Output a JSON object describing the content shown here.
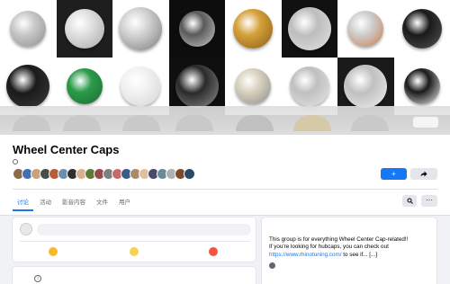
{
  "cover": {
    "tiles": [
      {
        "bg": "#ffffff",
        "cap": "#c9c9c9",
        "rim": "#8d8d8d"
      },
      {
        "bg": "#1e1e1e",
        "cap": "#e0e0e0",
        "rim": "#a6a6a6"
      },
      {
        "bg": "#ffffff",
        "cap": "#d2d2d2",
        "rim": "#7a7a7a"
      },
      {
        "bg": "#0d0d0d",
        "cap": "#5a5a5a",
        "rim": "#c8c8c8"
      },
      {
        "bg": "#ffffff",
        "cap": "#d4a13a",
        "rim": "#8a5b14"
      },
      {
        "bg": "#111111",
        "cap": "#bdbdbd",
        "rim": "#e3e3e3"
      },
      {
        "bg": "#ffffff",
        "cap": "#cfcfcf",
        "rim": "#c77b4a"
      },
      {
        "bg": "#ffffff",
        "cap": "#1a1a1a",
        "rim": "#555555"
      },
      {
        "bg": "#ffffff",
        "cap": "#1a1a1a",
        "rim": "#3c3c3c"
      },
      {
        "bg": "#ffffff",
        "cap": "#2b9b49",
        "rim": "#1d6b33"
      },
      {
        "bg": "#ffffff",
        "cap": "#f2f2f2",
        "rim": "#d4d4d4"
      },
      {
        "bg": "#0f0f0f",
        "cap": "#2a2a2a",
        "rim": "#8f8f8f"
      },
      {
        "bg": "#ffffff",
        "cap": "#d9d2bf",
        "rim": "#8c8c8c"
      },
      {
        "bg": "#ffffff",
        "cap": "#bfbfbf",
        "rim": "#e6e6e6"
      },
      {
        "bg": "#1a1a1a",
        "cap": "#c0c0c0",
        "rim": "#efefef"
      },
      {
        "bg": "#ffffff",
        "cap": "#1a1a1a",
        "rim": "#f2f2f2"
      }
    ]
  },
  "group": {
    "title": "Wheel Center Caps",
    "privacy_icon": "globe-icon",
    "member_colors": [
      "#8a6a4a",
      "#3f6fb5",
      "#c9a27a",
      "#4b4b4b",
      "#b85c38",
      "#6f8fb0",
      "#2f2f2f",
      "#d8b08c",
      "#5a7a3a",
      "#9a4a4a",
      "#7f7f7f",
      "#c96a6a",
      "#3a5a8a",
      "#a98a6a",
      "#e0c0a0",
      "#4a4a6a",
      "#6a8a9a",
      "#b0b0b0",
      "#7a4a2a",
      "#2a4a6a"
    ]
  },
  "actions": {
    "join_label": "+",
    "share_icon": "share-icon",
    "search_icon": "search-icon",
    "more_label": "···"
  },
  "tabs": [
    {
      "label": "讨论",
      "active": true
    },
    {
      "label": "活动",
      "active": false
    },
    {
      "label": "影音内容",
      "active": false
    },
    {
      "label": "文件",
      "active": false
    },
    {
      "label": "用户",
      "active": false
    }
  ],
  "composer": {
    "actions": [
      {
        "icon": "live-video-icon",
        "color": "#f7b928"
      },
      {
        "icon": "feeling-icon",
        "color": "#f7d354"
      },
      {
        "icon": "location-icon",
        "color": "#f5533d"
      }
    ]
  },
  "about": {
    "text_line1": "This group is for everything Wheel Center Cap-related!!",
    "text_line2": "If you're looking for hubcaps, you can check out",
    "link": "https://www.rhinotuning.com/",
    "text_after": " to see if... [...]"
  }
}
